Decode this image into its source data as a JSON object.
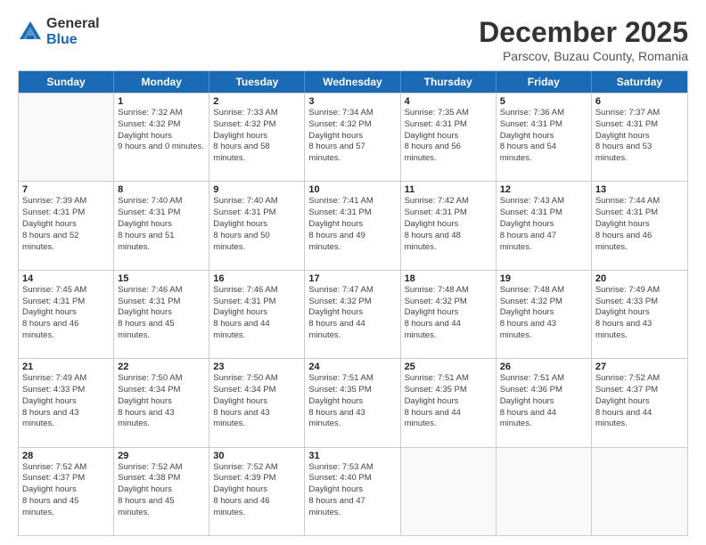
{
  "logo": {
    "general": "General",
    "blue": "Blue"
  },
  "title": "December 2025",
  "subtitle": "Parscov, Buzau County, Romania",
  "days_of_week": [
    "Sunday",
    "Monday",
    "Tuesday",
    "Wednesday",
    "Thursday",
    "Friday",
    "Saturday"
  ],
  "weeks": [
    [
      {
        "day": "",
        "sunrise": "",
        "sunset": "",
        "daylight": "",
        "empty": true
      },
      {
        "day": "1",
        "sunrise": "7:32 AM",
        "sunset": "4:32 PM",
        "daylight": "9 hours and 0 minutes.",
        "empty": false
      },
      {
        "day": "2",
        "sunrise": "7:33 AM",
        "sunset": "4:32 PM",
        "daylight": "8 hours and 58 minutes.",
        "empty": false
      },
      {
        "day": "3",
        "sunrise": "7:34 AM",
        "sunset": "4:32 PM",
        "daylight": "8 hours and 57 minutes.",
        "empty": false
      },
      {
        "day": "4",
        "sunrise": "7:35 AM",
        "sunset": "4:31 PM",
        "daylight": "8 hours and 56 minutes.",
        "empty": false
      },
      {
        "day": "5",
        "sunrise": "7:36 AM",
        "sunset": "4:31 PM",
        "daylight": "8 hours and 54 minutes.",
        "empty": false
      },
      {
        "day": "6",
        "sunrise": "7:37 AM",
        "sunset": "4:31 PM",
        "daylight": "8 hours and 53 minutes.",
        "empty": false
      }
    ],
    [
      {
        "day": "7",
        "sunrise": "7:39 AM",
        "sunset": "4:31 PM",
        "daylight": "8 hours and 52 minutes.",
        "empty": false
      },
      {
        "day": "8",
        "sunrise": "7:40 AM",
        "sunset": "4:31 PM",
        "daylight": "8 hours and 51 minutes.",
        "empty": false
      },
      {
        "day": "9",
        "sunrise": "7:40 AM",
        "sunset": "4:31 PM",
        "daylight": "8 hours and 50 minutes.",
        "empty": false
      },
      {
        "day": "10",
        "sunrise": "7:41 AM",
        "sunset": "4:31 PM",
        "daylight": "8 hours and 49 minutes.",
        "empty": false
      },
      {
        "day": "11",
        "sunrise": "7:42 AM",
        "sunset": "4:31 PM",
        "daylight": "8 hours and 48 minutes.",
        "empty": false
      },
      {
        "day": "12",
        "sunrise": "7:43 AM",
        "sunset": "4:31 PM",
        "daylight": "8 hours and 47 minutes.",
        "empty": false
      },
      {
        "day": "13",
        "sunrise": "7:44 AM",
        "sunset": "4:31 PM",
        "daylight": "8 hours and 46 minutes.",
        "empty": false
      }
    ],
    [
      {
        "day": "14",
        "sunrise": "7:45 AM",
        "sunset": "4:31 PM",
        "daylight": "8 hours and 46 minutes.",
        "empty": false
      },
      {
        "day": "15",
        "sunrise": "7:46 AM",
        "sunset": "4:31 PM",
        "daylight": "8 hours and 45 minutes.",
        "empty": false
      },
      {
        "day": "16",
        "sunrise": "7:46 AM",
        "sunset": "4:31 PM",
        "daylight": "8 hours and 44 minutes.",
        "empty": false
      },
      {
        "day": "17",
        "sunrise": "7:47 AM",
        "sunset": "4:32 PM",
        "daylight": "8 hours and 44 minutes.",
        "empty": false
      },
      {
        "day": "18",
        "sunrise": "7:48 AM",
        "sunset": "4:32 PM",
        "daylight": "8 hours and 44 minutes.",
        "empty": false
      },
      {
        "day": "19",
        "sunrise": "7:48 AM",
        "sunset": "4:32 PM",
        "daylight": "8 hours and 43 minutes.",
        "empty": false
      },
      {
        "day": "20",
        "sunrise": "7:49 AM",
        "sunset": "4:33 PM",
        "daylight": "8 hours and 43 minutes.",
        "empty": false
      }
    ],
    [
      {
        "day": "21",
        "sunrise": "7:49 AM",
        "sunset": "4:33 PM",
        "daylight": "8 hours and 43 minutes.",
        "empty": false
      },
      {
        "day": "22",
        "sunrise": "7:50 AM",
        "sunset": "4:34 PM",
        "daylight": "8 hours and 43 minutes.",
        "empty": false
      },
      {
        "day": "23",
        "sunrise": "7:50 AM",
        "sunset": "4:34 PM",
        "daylight": "8 hours and 43 minutes.",
        "empty": false
      },
      {
        "day": "24",
        "sunrise": "7:51 AM",
        "sunset": "4:35 PM",
        "daylight": "8 hours and 43 minutes.",
        "empty": false
      },
      {
        "day": "25",
        "sunrise": "7:51 AM",
        "sunset": "4:35 PM",
        "daylight": "8 hours and 44 minutes.",
        "empty": false
      },
      {
        "day": "26",
        "sunrise": "7:51 AM",
        "sunset": "4:36 PM",
        "daylight": "8 hours and 44 minutes.",
        "empty": false
      },
      {
        "day": "27",
        "sunrise": "7:52 AM",
        "sunset": "4:37 PM",
        "daylight": "8 hours and 44 minutes.",
        "empty": false
      }
    ],
    [
      {
        "day": "28",
        "sunrise": "7:52 AM",
        "sunset": "4:37 PM",
        "daylight": "8 hours and 45 minutes.",
        "empty": false
      },
      {
        "day": "29",
        "sunrise": "7:52 AM",
        "sunset": "4:38 PM",
        "daylight": "8 hours and 45 minutes.",
        "empty": false
      },
      {
        "day": "30",
        "sunrise": "7:52 AM",
        "sunset": "4:39 PM",
        "daylight": "8 hours and 46 minutes.",
        "empty": false
      },
      {
        "day": "31",
        "sunrise": "7:53 AM",
        "sunset": "4:40 PM",
        "daylight": "8 hours and 47 minutes.",
        "empty": false
      },
      {
        "day": "",
        "sunrise": "",
        "sunset": "",
        "daylight": "",
        "empty": true
      },
      {
        "day": "",
        "sunrise": "",
        "sunset": "",
        "daylight": "",
        "empty": true
      },
      {
        "day": "",
        "sunrise": "",
        "sunset": "",
        "daylight": "",
        "empty": true
      }
    ]
  ],
  "labels": {
    "sunrise": "Sunrise:",
    "sunset": "Sunset:",
    "daylight": "Daylight hours"
  }
}
